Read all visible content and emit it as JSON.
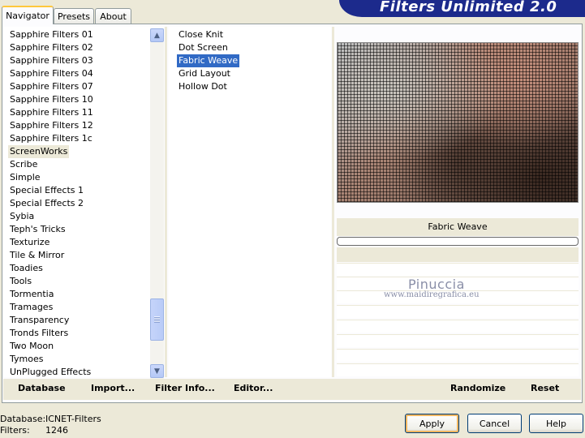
{
  "window": {
    "title": "Filters Unlimited 2.0"
  },
  "tabs": [
    {
      "label": "Navigator",
      "active": true
    },
    {
      "label": "Presets",
      "active": false
    },
    {
      "label": "About",
      "active": false
    }
  ],
  "categories": {
    "items": [
      "Sapphire Filters 01",
      "Sapphire Filters 02",
      "Sapphire Filters 03",
      "Sapphire Filters 04",
      "Sapphire Filters 07",
      "Sapphire Filters 10",
      "Sapphire Filters 11",
      "Sapphire Filters 12",
      "Sapphire Filters 1c",
      "ScreenWorks",
      "Scribe",
      "Simple",
      "Special Effects 1",
      "Special Effects 2",
      "Sybia",
      "Teph's Tricks",
      "Texturize",
      "Tile & Mirror",
      "Toadies",
      "Tools",
      "Tormentia",
      "Tramages",
      "Transparency",
      "Tronds Filters",
      "Two Moon",
      "Tymoes",
      "UnPlugged Effects"
    ],
    "selected": "ScreenWorks"
  },
  "filters": {
    "items": [
      "Close Knit",
      "Dot Screen",
      "Fabric Weave",
      "Grid Layout",
      "Hollow Dot"
    ],
    "selected": "Fabric Weave"
  },
  "preview": {
    "effect_name": "Fabric Weave",
    "progress": 0
  },
  "watermark": {
    "name": "Pinuccia",
    "url": "www.maidiregrafica.eu"
  },
  "toolbar": {
    "database": "Database",
    "import": "Import...",
    "filter_info": "Filter Info...",
    "editor": "Editor...",
    "randomize": "Randomize",
    "reset": "Reset"
  },
  "status": {
    "database_label": "Database:",
    "database_value": "ICNET-Filters",
    "filters_label": "Filters:",
    "filters_value": "1246"
  },
  "buttons": {
    "apply": "Apply",
    "cancel": "Cancel",
    "help": "Help"
  },
  "icons": {
    "scroll_up": "chevron-up-icon",
    "scroll_down": "chevron-down-icon"
  }
}
